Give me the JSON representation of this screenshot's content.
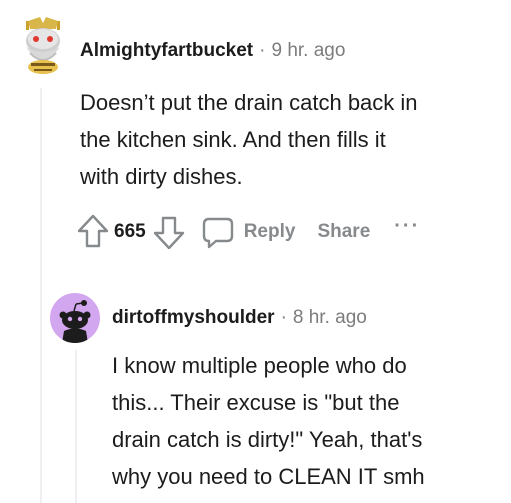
{
  "comment": {
    "author": "Almightyfartbucket",
    "time": "9 hr. ago",
    "body_lines": [
      "Doesn’t put the drain catch back in",
      "the kitchen sink. And then fills it",
      "with dirty dishes."
    ],
    "vote_count": "665",
    "reply_label": "Reply",
    "share_label": "Share",
    "more_label": "···",
    "icons": {
      "avatar": "snoo-avatar-icon",
      "upvote": "upvote-arrow-icon",
      "downvote": "downvote-arrow-icon",
      "reply": "speech-bubble-icon"
    }
  },
  "reply": {
    "author": "dirtoffmyshoulder",
    "time": "8 hr. ago",
    "body_lines": [
      "I know multiple people who do",
      "this... Their excuse is \"but the",
      "drain catch is dirty!\" Yeah, that's",
      "why you need to CLEAN IT smh"
    ],
    "icons": {
      "avatar": "default-snoo-avatar-icon"
    }
  },
  "colors": {
    "text": "#1c1c1c",
    "muted": "#7c7c7c",
    "icon_gray": "#878a8c",
    "thread_line": "#edeff1",
    "reply_avatar_bg": "#d3a7f0"
  }
}
